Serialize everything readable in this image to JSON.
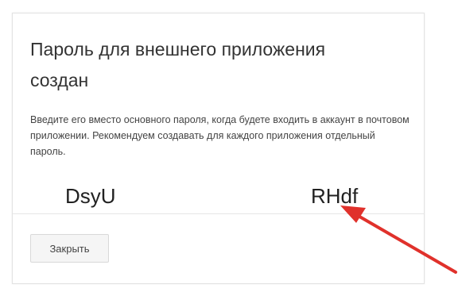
{
  "dialog": {
    "title": "Пароль для внешнего приложения создан",
    "description": "Введите его вместо основного пароля, когда будете входить в аккаунт в почтовом приложении. Рекомендуем создавать для каждого приложения отдельный пароль.",
    "password_first": "DsyU",
    "password_last": "RHdf",
    "close_label": "Закрыть"
  },
  "colors": {
    "annotation_arrow": "#e0312b"
  },
  "icons": {
    "annotation": "red-arrow-pointer"
  }
}
